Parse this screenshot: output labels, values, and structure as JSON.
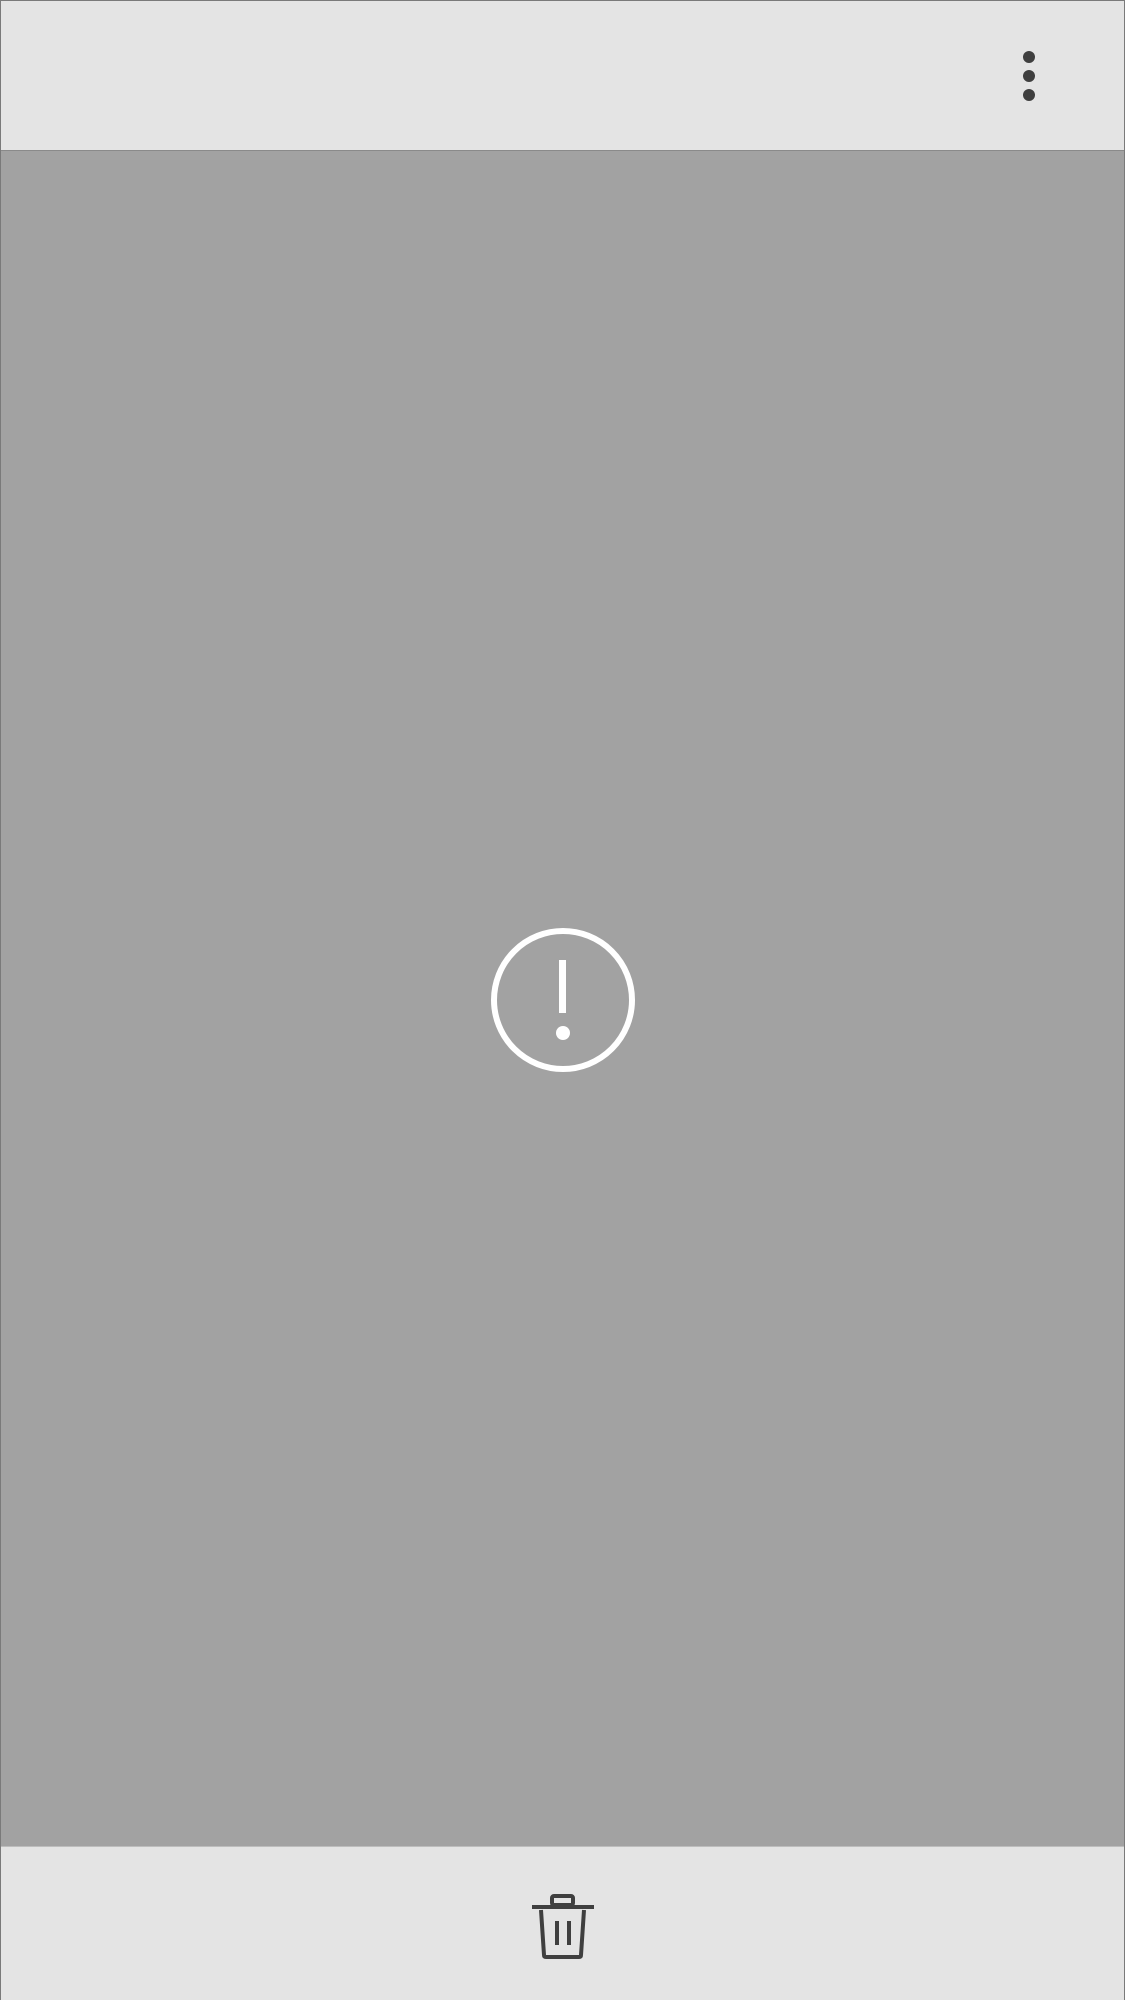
{
  "toolbar": {
    "more_options_icon": "more-vertical-icon"
  },
  "viewer": {
    "status_icon": "error-alert-icon"
  },
  "bottom_toolbar": {
    "delete_icon": "trash-icon"
  },
  "colors": {
    "bar_background": "#e4e4e4",
    "content_background": "#a2a2a2",
    "icon_dark": "#3f3f3f",
    "icon_light": "#ffffff"
  }
}
